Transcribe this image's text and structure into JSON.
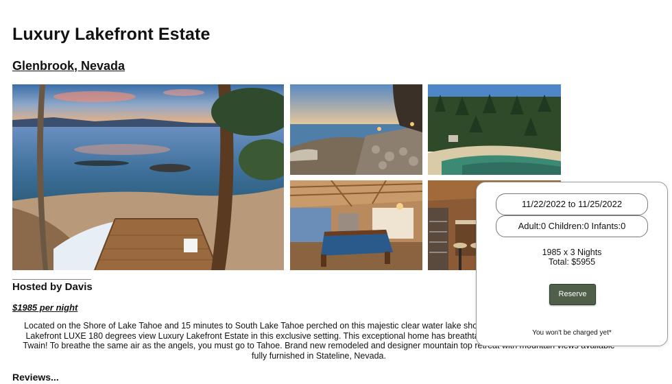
{
  "listing": {
    "title": "Luxury Lakefront Estate",
    "location": "Glenbrook, Nevada",
    "host": "Hosted by Davis",
    "price_per_night": "$1985 per night",
    "description": "Located on the Shore of Lake Tahoe and 15 minutes to South Lake Tahoe perched on this majestic clear water lake shore, accommodating up to 10 guests. Lakefront LUXE 180 degrees view Luxury Lakefront Estate in this exclusive setting. This exceptional home has breathtaking views once described by Mark Twain! To breathe the same air as the angels, you must go to Tahoe. Brand new remodeled and designer mountain top retreat with mountain views available fully furnished in Stateline, Nevada.",
    "reviews_heading": "Reviews..."
  },
  "photos": [
    {
      "subject": "lake-sunset-deck"
    },
    {
      "subject": "lakeshore-patio-evening"
    },
    {
      "subject": "aerial-forest-cove"
    },
    {
      "subject": "living-room-pool-table"
    },
    {
      "subject": "kitchen-bar-stools"
    }
  ],
  "booking": {
    "dates": "11/22/2022 to 11/25/2022",
    "guests": "Adult:0 Children:0 Infants:0",
    "nights_calc": "1985 x 3 Nights",
    "total": "Total: $5955",
    "reserve_label": "Reserve",
    "note": "You won't be charged yet*"
  },
  "colors": {
    "reserve_button": "#4f5f49",
    "text": "#111111",
    "panel_border": "#9a9a9a"
  }
}
